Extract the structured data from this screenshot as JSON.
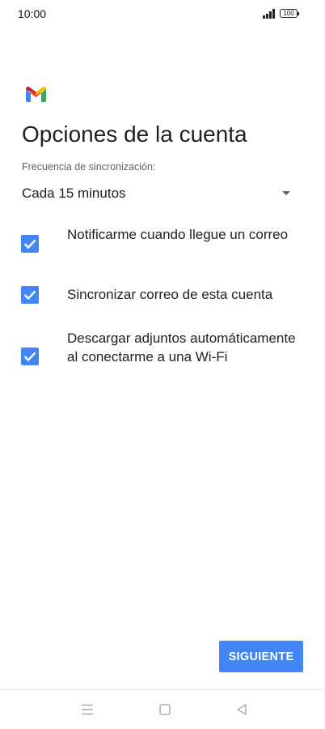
{
  "status_bar": {
    "time": "10:00",
    "battery": "100",
    "icons": [
      "signal-icon",
      "battery-icon"
    ]
  },
  "header": {
    "logo_icon": "gmail-logo-icon",
    "title": "Opciones de la cuenta"
  },
  "sync_frequency": {
    "label": "Frecuencia de sincronización:",
    "selected": "Cada 15 minutos"
  },
  "options": [
    {
      "label": "Notificarme cuando llegue un correo",
      "checked": true
    },
    {
      "label": "Sincronizar correo de esta cuenta",
      "checked": true
    },
    {
      "label": "Descargar adjuntos automáticamente al conectarme a una Wi-Fi",
      "checked": true
    }
  ],
  "footer": {
    "next_label": "SIGUIENTE"
  },
  "navigation": {
    "icons": [
      "menu-icon",
      "home-icon",
      "back-icon"
    ]
  },
  "colors": {
    "accent": "#4285f4",
    "text_primary": "#202124",
    "text_secondary": "#5f6368"
  }
}
